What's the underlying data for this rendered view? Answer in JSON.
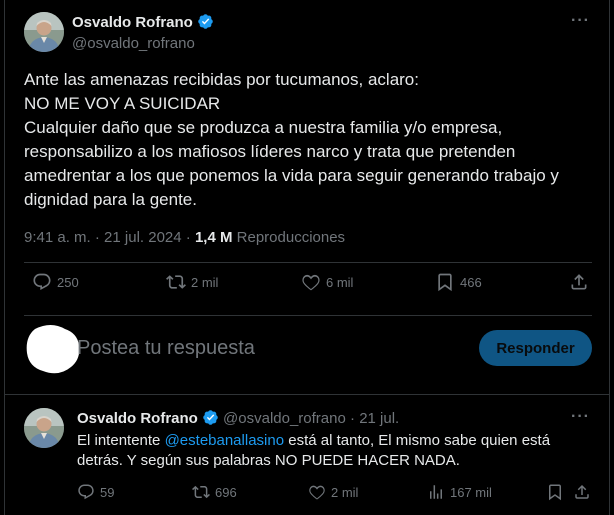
{
  "author": {
    "name": "Osvaldo Rofrano",
    "handle": "@osvaldo_rofrano"
  },
  "tweet": {
    "lines": [
      "Ante las amenazas recibidas por tucumanos, aclaro:",
      "NO ME VOY A SUICIDAR",
      "Cualquier daño que se produzca a nuestra familia y/o empresa,",
      "responsabilizo a los mafiosos líderes narco y trata que pretenden",
      "amedrentar a los que ponemos la vida para seguir generando trabajo y",
      "dignidad para la gente."
    ],
    "time": "9:41 a. m.",
    "dot": "·",
    "date": "21 jul. 2024",
    "views_count": "1,4 M",
    "views_label": "Reproducciones"
  },
  "actions": {
    "replies": "250",
    "reposts": "2 mil",
    "likes": "6 mil",
    "bookmarks": "466"
  },
  "reply_box": {
    "placeholder": "Postea tu respuesta",
    "button_label": "Responder"
  },
  "reply": {
    "name": "Osvaldo Rofrano",
    "handle": "@osvaldo_rofrano",
    "separator": "·",
    "date": "21 jul.",
    "text_prefix": "El intentente",
    "mention": "@estebanallasino",
    "text_suffix": "está al tanto, El mismo sabe quien está",
    "text_line2": "detrás. Y según sus palabras NO PUEDE HACER NADA.",
    "replies": "59",
    "reposts": "696",
    "likes": "2 mil",
    "views": "167 mil"
  },
  "colors": {
    "background": "#000000",
    "text": "#e7e9ea",
    "muted": "#71767b",
    "accent": "#1d9bf0",
    "border": "#2f3336"
  },
  "icons": [
    "verified-badge-icon",
    "more-icon",
    "reply-icon",
    "repost-icon",
    "like-icon",
    "bookmark-icon",
    "share-icon",
    "views-icon"
  ]
}
